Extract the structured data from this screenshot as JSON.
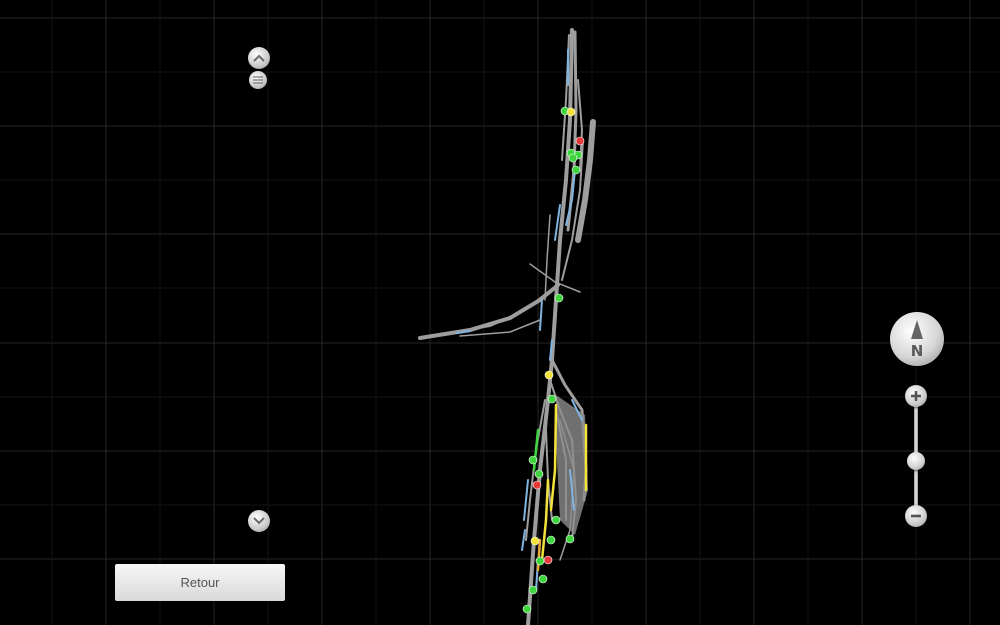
{
  "map": {
    "background_color": "#000000",
    "grid_color": "#2a2a2a",
    "track_color": "#9e9e9e",
    "highlight_color": "#7fb4e0",
    "signal_colors": {
      "green": "#3fd53f",
      "yellow": "#f2e23a",
      "red": "#e83a3a"
    }
  },
  "scroll_controls": {
    "up_icon": "chevron-up-icon",
    "menu_icon": "hamburger-icon",
    "down_icon": "chevron-down-icon"
  },
  "compass": {
    "label": "N",
    "icon": "compass-icon"
  },
  "zoom": {
    "in_icon": "plus-icon",
    "out_icon": "minus-icon",
    "level": 0.5
  },
  "back_button": {
    "label": "Retour"
  }
}
